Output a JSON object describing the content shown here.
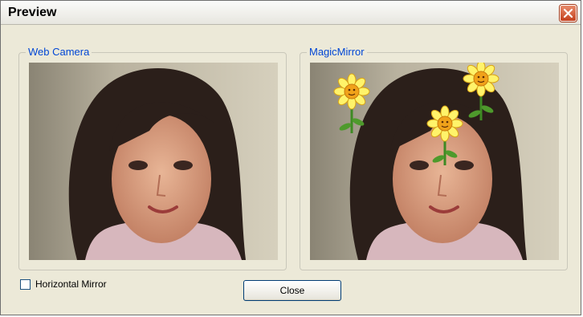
{
  "window": {
    "title": "Preview"
  },
  "groups": {
    "web_camera": {
      "label": "Web Camera"
    },
    "magic_mirror": {
      "label": "MagicMirror"
    }
  },
  "controls": {
    "horizontal_mirror": {
      "label": "Horizontal Mirror",
      "checked": false
    },
    "close_button": {
      "label": "Close"
    }
  },
  "icons": {
    "title_close": "close-icon",
    "overlay": "daisy-flower-icon"
  },
  "colors": {
    "group_label": "#0046d5",
    "close_red": "#c4401e",
    "dialog_bg": "#ece9d8"
  }
}
